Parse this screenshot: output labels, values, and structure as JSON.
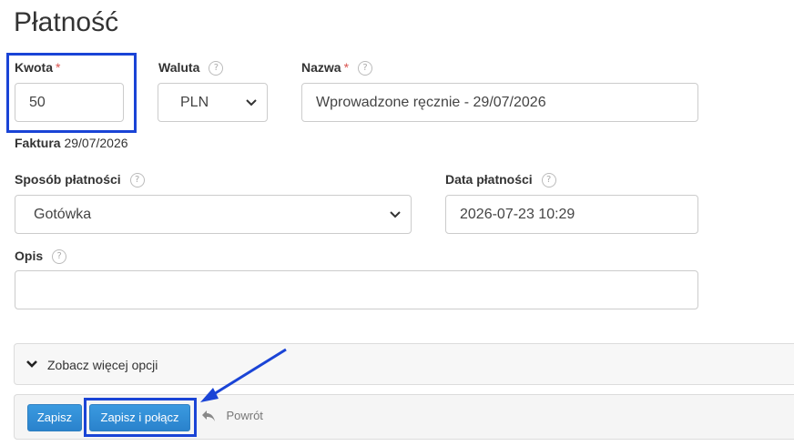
{
  "page": {
    "title": "Płatność"
  },
  "form": {
    "amount": {
      "label": "Kwota",
      "required_mark": "*",
      "value": "50"
    },
    "currency": {
      "label": "Waluta",
      "help": "?",
      "value": "PLN"
    },
    "name": {
      "label": "Nazwa",
      "required_mark": "*",
      "help": "?",
      "value": "Wprowadzone ręcznie - 29/07/2026"
    },
    "invoice": {
      "label": "Faktura",
      "date": "29/07/2026"
    },
    "payment_method": {
      "label": "Sposób płatności",
      "help": "?",
      "value": "Gotówka"
    },
    "payment_date": {
      "label": "Data płatności",
      "help": "?",
      "value": "2026-07-23 10:29"
    },
    "description": {
      "label": "Opis",
      "help": "?",
      "value": ""
    }
  },
  "more_options": {
    "label": "Zobacz więcej opcji"
  },
  "actions": {
    "save": "Zapisz",
    "save_and_merge": "Zapisz i połącz",
    "back": "Powrót"
  },
  "colors": {
    "highlight": "#1a44d6",
    "button": "#2a82cc",
    "required": "#d9534f"
  }
}
